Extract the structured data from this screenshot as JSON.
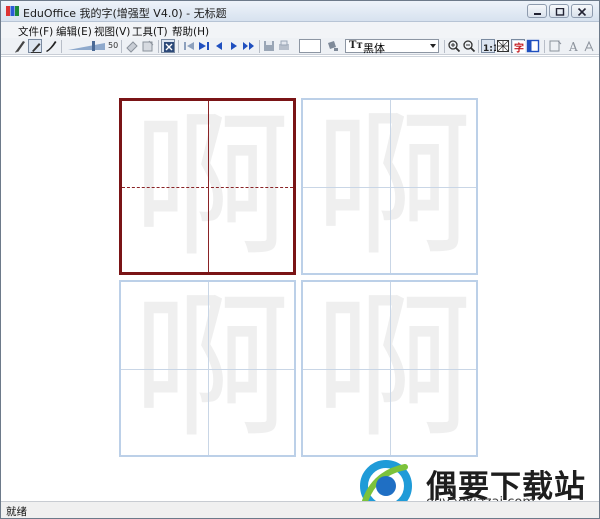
{
  "window": {
    "title": "EduOffice 我的字(增强型 V4.0) - 无标题",
    "buttons": [
      "minimize",
      "maximize",
      "close"
    ]
  },
  "menu": {
    "items": [
      {
        "label": "文件(F)"
      },
      {
        "label": "编辑(E)"
      },
      {
        "label": "视图(V)"
      },
      {
        "label": "工具(T)"
      },
      {
        "label": "帮助(H)"
      }
    ]
  },
  "toolbar": {
    "pen_size_value": "50",
    "font_name": "黑体",
    "font_prefix": "Tт",
    "page_number": "",
    "icons": [
      "pencil-icon",
      "brush-icon",
      "calligraphy-brush-icon",
      "eraser-icon",
      "clear-icon",
      "stroke-order-icon",
      "first-icon",
      "last-icon",
      "prev-icon",
      "next-icon",
      "end-icon",
      "save-icon",
      "print-icon",
      "paint-icon",
      "zoom-in-icon",
      "zoom-out-icon",
      "actual-size-icon",
      "grid-icon",
      "sample-char-icon",
      "layout-icon",
      "font-color-icon",
      "text-icon"
    ]
  },
  "canvas": {
    "character": "啊",
    "cells": [
      {
        "id": 1,
        "active": true
      },
      {
        "id": 2,
        "active": false
      },
      {
        "id": 3,
        "active": false
      },
      {
        "id": 4,
        "active": false
      }
    ]
  },
  "watermark": {
    "title": "偶要下载站",
    "url": "ouyaoxiazai.com"
  },
  "status": {
    "text": "就绪"
  },
  "colors": {
    "active_cell_border": "#7a1416",
    "cell_border": "#bcd0e8",
    "guide_line": "#c9d6e6",
    "glyph_fill": "#efefef"
  }
}
